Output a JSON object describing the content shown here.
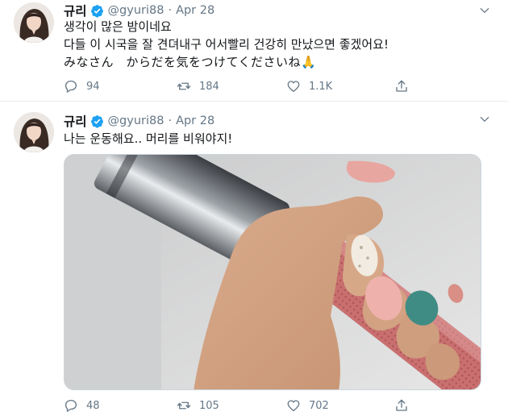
{
  "colors": {
    "verified": "#1da1f2",
    "muted": "#657786",
    "text": "#14171a",
    "divider": "#e6ecf0"
  },
  "tweets": [
    {
      "author": {
        "name": "규리",
        "handle": "@gyuri88",
        "verified": true,
        "avatar_icon": "avatar-photo"
      },
      "date": "Apr 28",
      "separator": "·",
      "lines": [
        "생각이 많은 밤이네요",
        "다들 이 시국을 잘 견뎌내구 어서빨리 건강히 만났으면 좋겠어요!",
        "みなさん　からだを気をつけてくださいね🙏"
      ],
      "stats": {
        "replies": "94",
        "retweets": "184",
        "likes": "1.1K"
      }
    },
    {
      "author": {
        "name": "규리",
        "handle": "@gyuri88",
        "verified": true,
        "avatar_icon": "avatar-photo"
      },
      "date": "Apr 28",
      "separator": "·",
      "lines": [
        "나는 운동해요.. 머리를 비워야지!"
      ],
      "media": {
        "type": "photo"
      },
      "stats": {
        "replies": "48",
        "retweets": "105",
        "likes": "702"
      }
    }
  ]
}
